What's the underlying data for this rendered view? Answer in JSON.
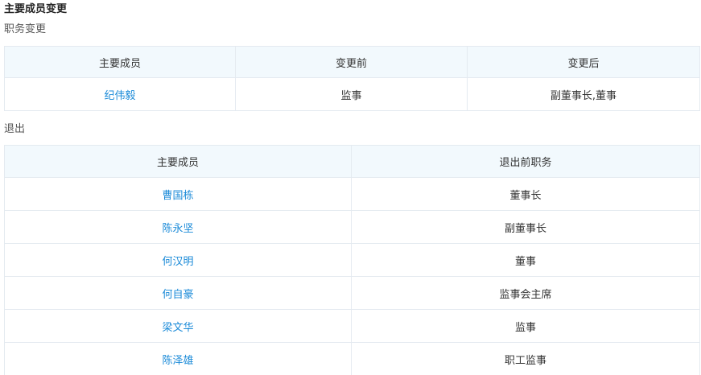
{
  "title": "主要成员变更",
  "position_change": {
    "label": "职务变更",
    "headers": [
      "主要成员",
      "变更前",
      "变更后"
    ],
    "rows": [
      {
        "name": "纪伟毅",
        "before": "监事",
        "after": "副董事长,董事"
      }
    ]
  },
  "exit": {
    "label": "退出",
    "headers": [
      "主要成员",
      "退出前职务"
    ],
    "rows": [
      {
        "name": "曹国栋",
        "role": "董事长"
      },
      {
        "name": "陈永坚",
        "role": "副董事长"
      },
      {
        "name": "何汉明",
        "role": "董事"
      },
      {
        "name": "何自豪",
        "role": "监事会主席"
      },
      {
        "name": "梁文华",
        "role": "监事"
      },
      {
        "name": "陈泽雄",
        "role": "职工监事"
      }
    ]
  },
  "colors": {
    "link": "#1a8ad8",
    "header_bg": "#f2f9fd",
    "border": "#e4eaf0"
  }
}
